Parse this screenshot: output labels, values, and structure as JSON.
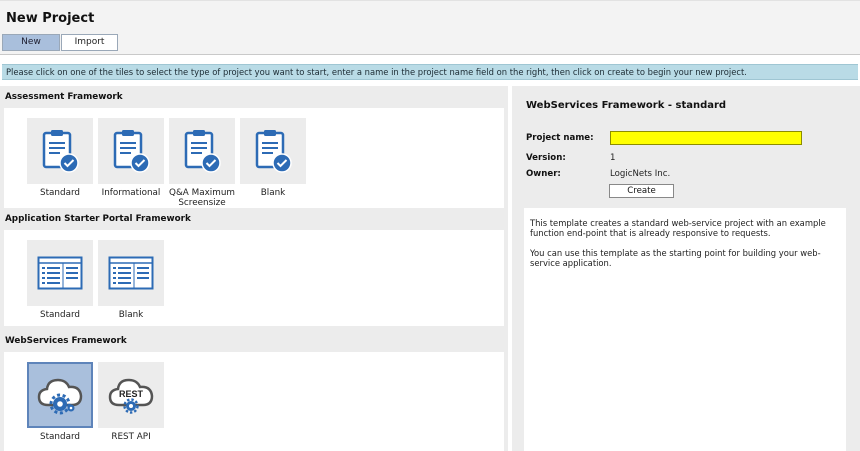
{
  "page": {
    "title": "New Project"
  },
  "tabs": [
    {
      "label": "New",
      "selected": true
    },
    {
      "label": "Import",
      "selected": false
    }
  ],
  "banner": "Please click on one of the tiles to select the type of project you want to start, enter a name in the project name field on the right, then click on create to begin your new project.",
  "sections": [
    {
      "title": "Assessment Framework",
      "tiles": [
        {
          "label": "Standard",
          "icon": "clipboard-check-icon"
        },
        {
          "label": "Informational",
          "icon": "clipboard-check-icon"
        },
        {
          "label": "Q&A Maximum Screensize",
          "icon": "clipboard-check-icon"
        },
        {
          "label": "Blank",
          "icon": "clipboard-check-icon"
        }
      ]
    },
    {
      "title": "Application Starter Portal Framework",
      "tiles": [
        {
          "label": "Standard",
          "icon": "portal-layout-icon"
        },
        {
          "label": "Blank",
          "icon": "portal-layout-icon"
        }
      ]
    },
    {
      "title": "WebServices Framework",
      "tiles": [
        {
          "label": "Standard",
          "icon": "cloud-gear-icon",
          "selected": true
        },
        {
          "label": "REST API",
          "icon": "rest-cloud-icon",
          "icon_text": "REST"
        }
      ]
    }
  ],
  "details": {
    "title": "WebServices Framework - standard",
    "project_name_label": "Project name:",
    "project_name_value": "",
    "version_label": "Version:",
    "version_value": "1",
    "owner_label": "Owner:",
    "owner_value": "LogicNets Inc.",
    "create_label": "Create",
    "description": [
      "This template creates a standard web-service project with an example function end-point that is already responsive to requests.",
      "You can use this template as the starting point for building your web-service application."
    ]
  },
  "colors": {
    "banner": "#b9dbe6",
    "selected_tile": "#a9bfdc",
    "icon_blue": "#2d6bb5",
    "name_field": "#ffff00"
  }
}
